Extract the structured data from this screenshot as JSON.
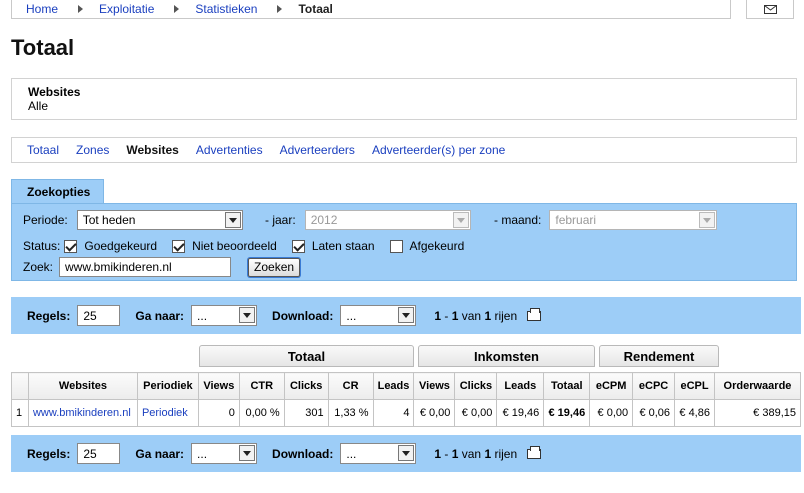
{
  "breadcrumb": {
    "home": "Home",
    "exploitatie": "Exploitatie",
    "statistieken": "Statistieken",
    "current": "Totaal"
  },
  "page_title": "Totaal",
  "filter": {
    "label": "Websites",
    "value": "Alle"
  },
  "subnav": [
    "Totaal",
    "Zones",
    "Websites",
    "Advertenties",
    "Adverteerders",
    "Adverteerder(s) per zone"
  ],
  "subnav_active": "Websites",
  "search": {
    "tab_label": "Zoekopties",
    "periode_label": "Periode:",
    "periode_value": "Tot heden",
    "jaar_label": "- jaar:",
    "jaar_value": "2012",
    "maand_label": "- maand:",
    "maand_value": "februari",
    "status_label": "Status:",
    "statuses": [
      {
        "label": "Goedgekeurd",
        "checked": true
      },
      {
        "label": "Niet beoordeeld",
        "checked": true
      },
      {
        "label": "Laten staan",
        "checked": true
      },
      {
        "label": "Afgekeurd",
        "checked": false
      }
    ],
    "zoek_label": "Zoek:",
    "zoek_value": "www.bmikinderen.nl",
    "zoek_button": "Zoeken"
  },
  "pager": {
    "regels_label": "Regels:",
    "regels_value": "25",
    "ganaar_label": "Ga naar:",
    "ganaar_value": "...",
    "download_label": "Download:",
    "download_value": "...",
    "range_from": "1",
    "range_sep": " - ",
    "range_to": "1",
    "van": " van ",
    "total": "1",
    "rijen": " rijen"
  },
  "groups": {
    "totaal": "Totaal",
    "inkomsten": "Inkomsten",
    "rendement": "Rendement"
  },
  "table": {
    "headers": [
      "",
      "Websites",
      "Periodiek",
      "Views",
      "CTR",
      "Clicks",
      "CR",
      "Leads",
      "Views",
      "Clicks",
      "Leads",
      "Totaal",
      "eCPM",
      "eCPC",
      "eCPL",
      "Orderwaarde"
    ],
    "row": [
      "1",
      "www.bmikinderen.nl",
      "Periodiek",
      "0",
      "0,00 %",
      "301",
      "1,33 %",
      "4",
      "€ 0,00",
      "€ 0,00",
      "€ 19,46",
      "€ 19,46",
      "€ 0,00",
      "€ 0,06",
      "€ 4,86",
      "€ 389,15"
    ]
  }
}
